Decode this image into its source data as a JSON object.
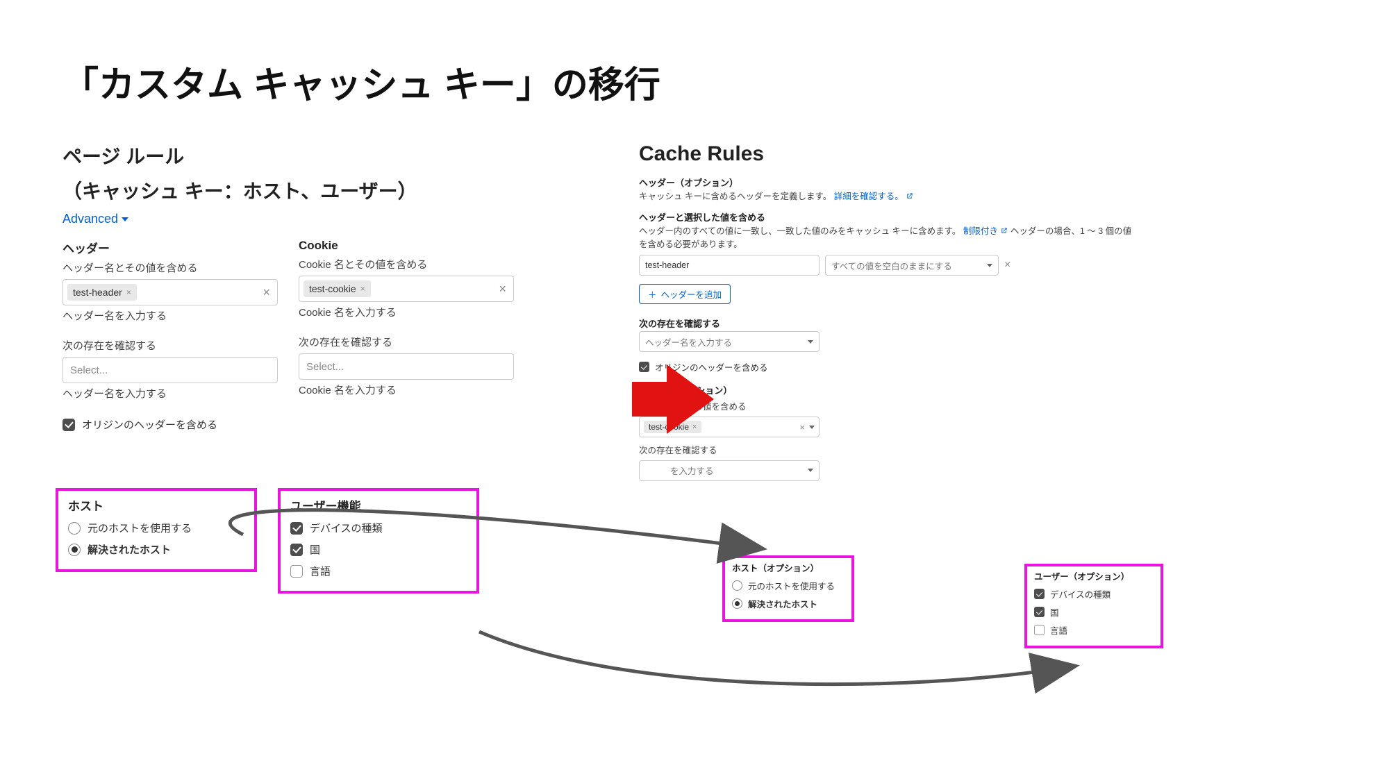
{
  "title": "「カスタム キャッシュ キー」の移行",
  "left": {
    "heading1": "ページ ルール",
    "heading2": "（キャッシュ キー：ホスト、ユーザー）",
    "advanced": "Advanced",
    "header_section": {
      "title": "ヘッダー",
      "include_label": "ヘッダー名とその値を含める",
      "chip": "test-header",
      "hint": "ヘッダー名を入力する",
      "presence_label": "次の存在を確認する",
      "select_ph": "Select...",
      "hint2": "ヘッダー名を入力する"
    },
    "cookie_section": {
      "title": "Cookie",
      "include_label": "Cookie 名とその値を含める",
      "chip": "test-cookie",
      "hint": "Cookie 名を入力する",
      "presence_label": "次の存在を確認する",
      "select_ph": "Select...",
      "hint2": "Cookie 名を入力する"
    },
    "origin_header_label": "オリジンのヘッダーを含める",
    "host": {
      "title": "ホスト",
      "opt1": "元のホストを使用する",
      "opt2": "解決されたホスト"
    },
    "user": {
      "title": "ユーザー機能",
      "opt1": "デバイスの種類",
      "opt2": "国",
      "opt3": "言語"
    }
  },
  "right": {
    "heading": "Cache Rules",
    "hdr_opt_title": "ヘッダー（オプション）",
    "hdr_opt_desc": "キャッシュ キーに含めるヘッダーを定義します。",
    "hdr_opt_link": "詳細を確認する。",
    "hdr_sel_title": "ヘッダーと選択した値を含める",
    "hdr_sel_desc_a": "ヘッダー内のすべての値に一致し、一致した値のみをキャッシュ キーに含めます。",
    "hdr_sel_link": "制限付き",
    "hdr_sel_desc_b": " ヘッダーの場合、1 〜 3 個の値を含める必要があります。",
    "hdr_input_val": "test-header",
    "hdr_select_ph": "すべての値を空白のままにする",
    "add_header_btn": "ヘッダーを追加",
    "presence_title": "次の存在を確認する",
    "presence_ph": "ヘッダー名を入力する",
    "origin_chk": "オリジンのヘッダーを含める",
    "cookie_title": "Cookie（オプション）",
    "cookie_include": "Cookie 名とその値を含める",
    "cookie_chip": "test-cookie",
    "cookie_presence": "次の存在を確認する",
    "cookie_ph": "を入力する",
    "host": {
      "title": "ホスト（オプション）",
      "opt1": "元のホストを使用する",
      "opt2": "解決されたホスト"
    },
    "user": {
      "title": "ユーザー（オプション）",
      "opt1": "デバイスの種類",
      "opt2": "国",
      "opt3": "言語"
    }
  }
}
